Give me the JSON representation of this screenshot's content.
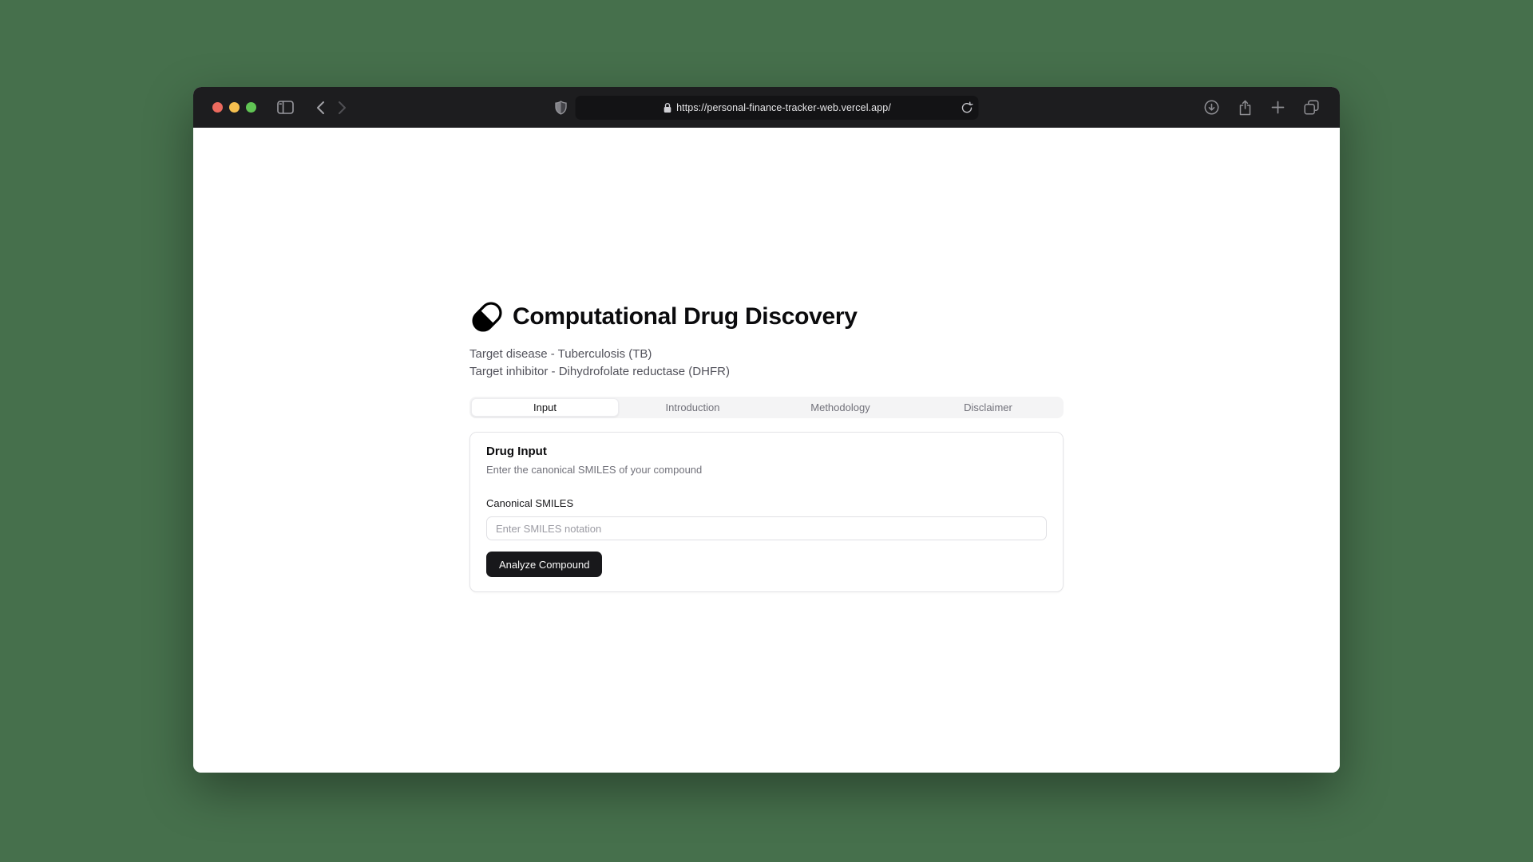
{
  "browser": {
    "url": "https://personal-finance-tracker-web.vercel.app/"
  },
  "page": {
    "title": "Computational Drug Discovery",
    "subtitle_line1": "Target disease - Tuberculosis (TB)",
    "subtitle_line2": "Target inhibitor - Dihydrofolate reductase (DHFR)",
    "tabs": [
      {
        "label": "Input",
        "active": true
      },
      {
        "label": "Introduction",
        "active": false
      },
      {
        "label": "Methodology",
        "active": false
      },
      {
        "label": "Disclaimer",
        "active": false
      }
    ],
    "card": {
      "heading": "Drug Input",
      "description": "Enter the canonical SMILES of your compound",
      "field_label": "Canonical SMILES",
      "input_placeholder": "Enter SMILES notation",
      "input_value": "",
      "submit_label": "Analyze Compound"
    }
  },
  "colors": {
    "backdrop": "#46704c",
    "toolbar": "#1d1d1f",
    "urlfield": "#131315",
    "tl-red": "#ec6a5e",
    "tl-yellow": "#f5bf4f",
    "tl-green": "#61c554",
    "btn": "#18181b",
    "muted": "#71717a",
    "subtle": "#52525b"
  }
}
